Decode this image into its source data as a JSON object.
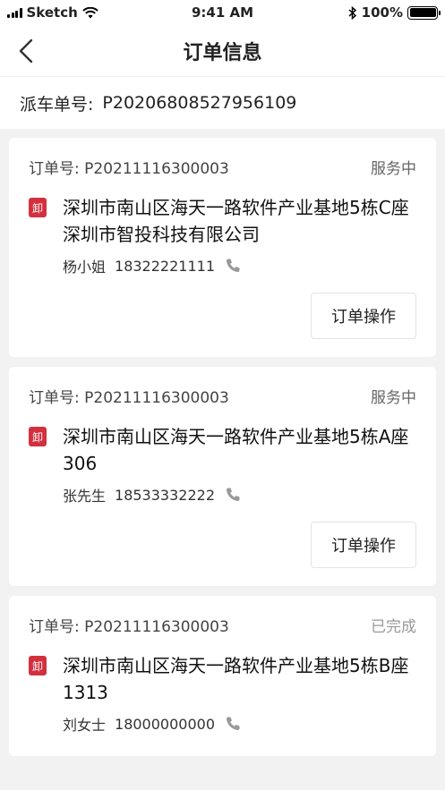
{
  "statusbar": {
    "carrier": "Sketch",
    "time": "9:41 AM",
    "battery": "100%"
  },
  "navbar": {
    "title": "订单信息",
    "back_icon": "chevron-left-icon"
  },
  "dispatch": {
    "label": "派车单号:",
    "number": "P20206808527956109"
  },
  "orders": [
    {
      "order_label": "订单号:",
      "order_no": "P20211116300003",
      "status": "服务中",
      "tag": "卸",
      "address": "深圳市南山区海天一路软件产业基地5栋C座深圳市智投科技有限公司",
      "contact_name": "杨小姐",
      "contact_phone": "18322221111",
      "action_label": "订单操作"
    },
    {
      "order_label": "订单号:",
      "order_no": "P20211116300003",
      "status": "服务中",
      "tag": "卸",
      "address": "深圳市南山区海天一路软件产业基地5栋A座306",
      "contact_name": "张先生",
      "contact_phone": "18533332222",
      "action_label": "订单操作"
    },
    {
      "order_label": "订单号:",
      "order_no": "P20211116300003",
      "status": "已完成",
      "tag": "卸",
      "address": "深圳市南山区海天一路软件产业基地5栋B座1313",
      "contact_name": "刘女士",
      "contact_phone": "18000000000"
    }
  ],
  "colors": {
    "tag_red": "#d3303e",
    "background": "#f2f2f2"
  }
}
